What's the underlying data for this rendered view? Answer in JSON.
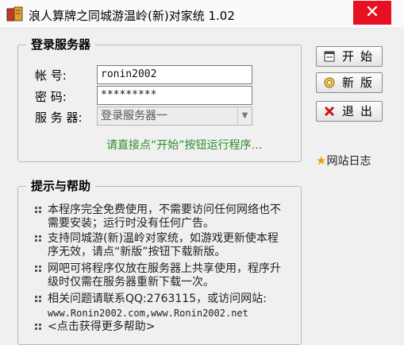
{
  "window": {
    "title": "浪人算牌之同城游温岭(新)对家统 1.02",
    "close_glyph": "✕"
  },
  "login": {
    "group_title": "登录服务器",
    "account_label": "帐    号:",
    "account_value": "ronin2002",
    "password_label": "密    码:",
    "password_value": "*********",
    "server_label": "服 务 器:",
    "server_selected": "登录服务器一",
    "hint": "请直接点“开始”按钮运行程序…"
  },
  "buttons": {
    "start": "开始",
    "update": "新版",
    "exit": "退出"
  },
  "sidebar": {
    "log_link": "网站日志"
  },
  "help": {
    "group_title": "提示与帮助",
    "items": [
      "本程序完全免费使用，不需要访问任何网络也不需要安装；运行时没有任何广告。",
      "支持同城游(新)温岭对家统，如游戏更新使本程序无效，请点“新版”按钮下载新版。",
      "网吧可将程序仅放在服务器上共享使用，程序升级时仅需在服务器重新下载一次。",
      "相关问题请联系QQ:2763115，或访问网站:",
      "www.Ronin2002.com,www.Ronin2002.net",
      "<点击获得更多帮助>"
    ]
  },
  "icons": {
    "app": "app-book-icon",
    "start": "window-icon",
    "update": "gear-icon",
    "exit": "red-x-icon",
    "log": "star-icon",
    "bullet": "four-dot-bullet-icon"
  }
}
